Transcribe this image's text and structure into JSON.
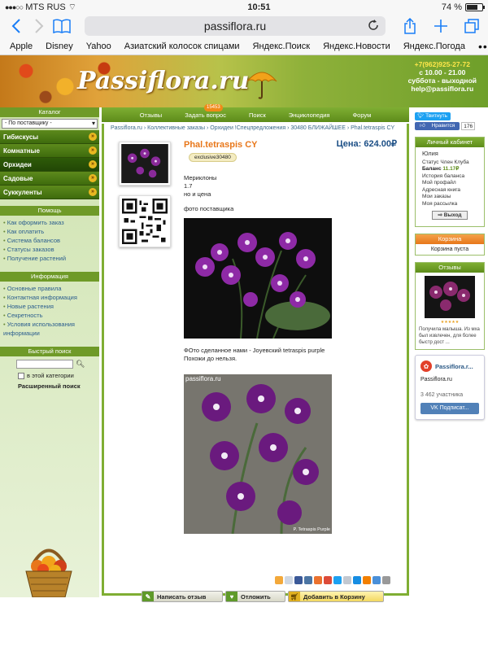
{
  "status": {
    "carrier": "MTS RUS",
    "time": "10:51",
    "battery": "74 %",
    "battery_level": 0.74
  },
  "browser": {
    "url": "passiflora.ru"
  },
  "bookmarks": [
    "Apple",
    "Disney",
    "Yahoo",
    "Азиатский колосок спицами",
    "Яндекс.Поиск",
    "Яндекс.Новости",
    "Яндекс.Погода"
  ],
  "header": {
    "logo": "Passiflora.ru",
    "phone": "+7(962)925-27-72",
    "hours": "с 10.00 - 21.00",
    "weekend": "суббота - выходной",
    "email": "help@passiflora.ru"
  },
  "sidebar": {
    "catalog_title": "Каталог",
    "supplier_select": "- По поставщику -",
    "categories": [
      "Гибискусы",
      "Комнатные",
      "Орхидеи",
      "Садовые",
      "Суккуленты"
    ],
    "help_title": "Помощь",
    "help_items": [
      "Как оформить заказ",
      "Как оплатить",
      "Система балансов",
      "Статусы заказов",
      "Получение растений"
    ],
    "info_title": "Информация",
    "info_items": [
      "Основные правила",
      "Контактная информация",
      "Новые растения",
      "Секретность",
      "Условия использования информации"
    ],
    "search_title": "Быстрый поиск",
    "search_in_category": "в этой категории",
    "advanced_search": "Расширенный поиск"
  },
  "nav": {
    "items": [
      "Отзывы",
      "Задать вопрос",
      "Поиск",
      "Энциклопедия",
      "Форум"
    ],
    "badge": "15453"
  },
  "breadcrumb": "Passiflora.ru › Коллективные заказы › Орхидеи !Спецпредложения › 30480 БЛИЖАЙШЕЕ › Phal.tetraspis CY",
  "product": {
    "title": "Phal.tetraspis CY",
    "code": "exclusive30480",
    "price": "Цена: 624.00₽",
    "desc": [
      "Мериклоны",
      "1.7",
      "но и цена"
    ],
    "photo_caption": "фото поставщика",
    "caption2_line1": "ФОто сделанное нами -   Joyевский tetraspis purple",
    "caption2_line2": "Похожи до нельзя.",
    "watermark": "passiflora.ru",
    "photo2_label": "P. Tetraspis Purple"
  },
  "actions": {
    "review": "Написать отзыв",
    "defer": "Отложить",
    "cart": "Добавить в Корзину"
  },
  "share": {
    "tweet": "Твитнуть",
    "like": "Нравится",
    "like_count": "176"
  },
  "cabinet": {
    "title": "Личный кабинет",
    "name": "Юлия",
    "status": "Статус Член Клуба",
    "balance_label": "Баланс",
    "balance": "11.17₽",
    "links": [
      "История баланса",
      "Мой профайл",
      "Адресная книга",
      "Мои заказы",
      "Моя рассылка"
    ],
    "exit": "Выход"
  },
  "cart": {
    "title": "Корзина",
    "empty": "Корзина пуста"
  },
  "reviews": {
    "title": "Отзывы",
    "stars": "★★★★★",
    "text": "Получила малыша. Из мха был извлечен, для более быстр дост ..."
  },
  "vk": {
    "group": "Passiflora.r...",
    "name": "Passiflora.ru",
    "members": "3 462 участника",
    "subscribe": "Подписат..."
  },
  "colors": {
    "green": "#5d8c1a",
    "orange": "#e8771a",
    "price_blue": "#1c4f86"
  }
}
